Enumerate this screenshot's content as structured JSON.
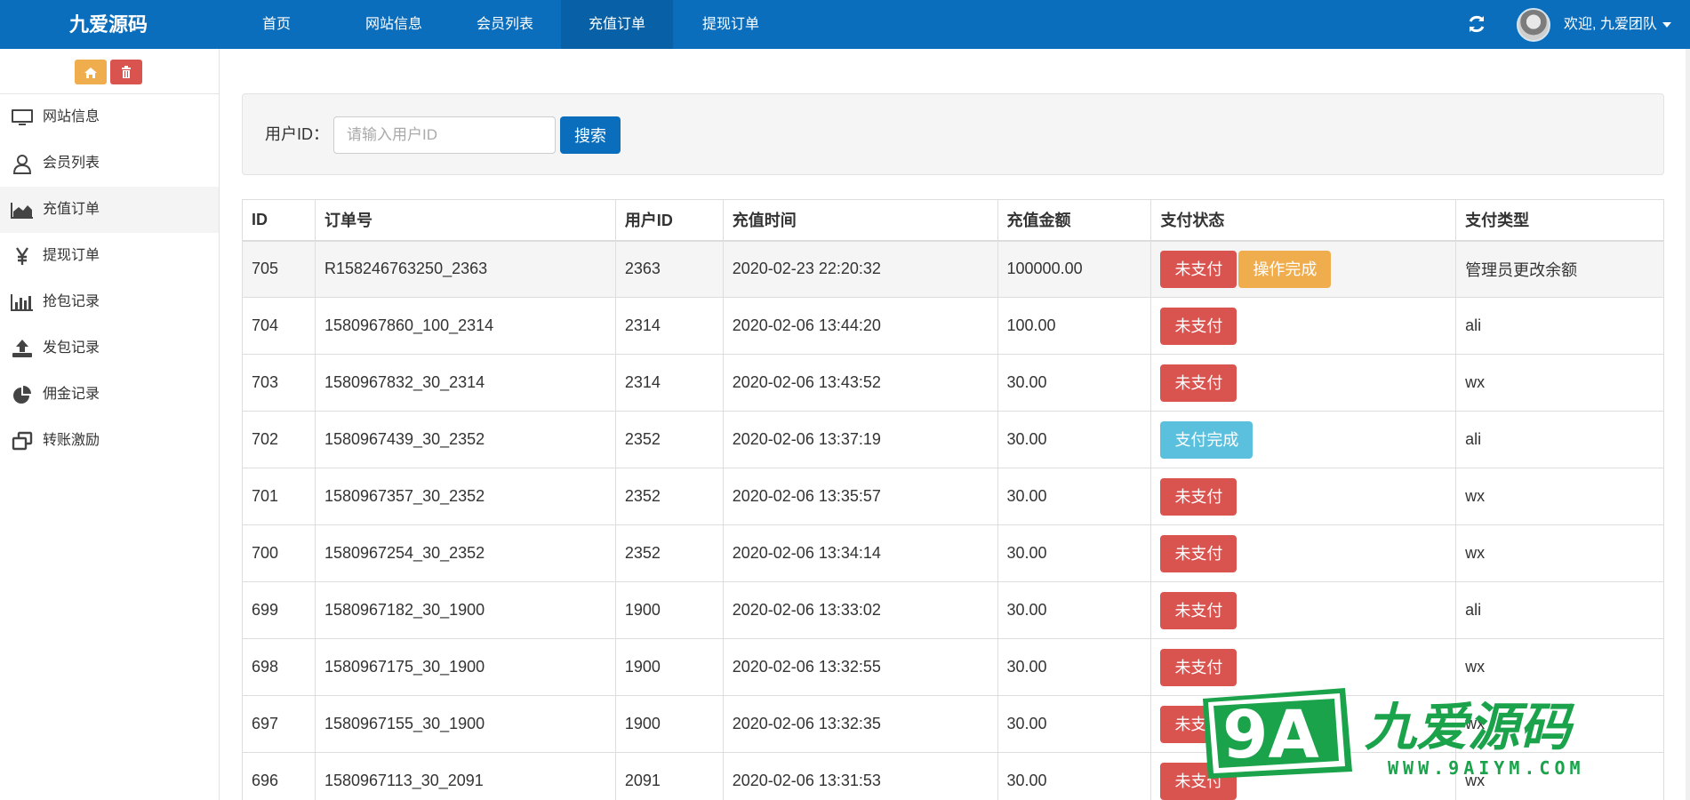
{
  "brand": {
    "name": "九爱源码"
  },
  "nav": {
    "items": [
      {
        "label": "首页",
        "active": false
      },
      {
        "label": "网站信息",
        "active": false
      },
      {
        "label": "会员列表",
        "active": false
      },
      {
        "label": "充值订单",
        "active": true
      },
      {
        "label": "提现订单",
        "active": false
      }
    ]
  },
  "header": {
    "welcome": "欢迎, 九爱团队"
  },
  "sidebar": {
    "items": [
      {
        "label": "网站信息",
        "icon": "monitor-icon"
      },
      {
        "label": "会员列表",
        "icon": "user-icon"
      },
      {
        "label": "充值订单",
        "icon": "area-chart-icon",
        "active": true
      },
      {
        "label": "提现订单",
        "icon": "yen-icon"
      },
      {
        "label": "抢包记录",
        "icon": "bar-chart-icon"
      },
      {
        "label": "发包记录",
        "icon": "upload-icon"
      },
      {
        "label": "佣金记录",
        "icon": "pie-chart-icon"
      },
      {
        "label": "转账激励",
        "icon": "clone-icon"
      }
    ]
  },
  "search": {
    "label": "用户ID：",
    "placeholder": "请输入用户ID",
    "button": "搜索",
    "value": ""
  },
  "table": {
    "headers": [
      "ID",
      "订单号",
      "用户ID",
      "充值时间",
      "充值金额",
      "支付状态",
      "支付类型"
    ],
    "rows": [
      {
        "id": "705",
        "order_no": "R158246763250_2363",
        "user_id": "2363",
        "time": "2020-02-23 22:20:32",
        "amount": "100000.00",
        "status": "未支付",
        "status_color": "#d9534f",
        "action": "操作完成",
        "type": "管理员更改余额",
        "highlight": true
      },
      {
        "id": "704",
        "order_no": "1580967860_100_2314",
        "user_id": "2314",
        "time": "2020-02-06 13:44:20",
        "amount": "100.00",
        "status": "未支付",
        "status_color": "#d9534f",
        "action": "",
        "type": "ali"
      },
      {
        "id": "703",
        "order_no": "1580967832_30_2314",
        "user_id": "2314",
        "time": "2020-02-06 13:43:52",
        "amount": "30.00",
        "status": "未支付",
        "status_color": "#d9534f",
        "action": "",
        "type": "wx"
      },
      {
        "id": "702",
        "order_no": "1580967439_30_2352",
        "user_id": "2352",
        "time": "2020-02-06 13:37:19",
        "amount": "30.00",
        "status": "支付完成",
        "status_color": "#5bc0de",
        "action": "",
        "type": "ali"
      },
      {
        "id": "701",
        "order_no": "1580967357_30_2352",
        "user_id": "2352",
        "time": "2020-02-06 13:35:57",
        "amount": "30.00",
        "status": "未支付",
        "status_color": "#d9534f",
        "action": "",
        "type": "wx"
      },
      {
        "id": "700",
        "order_no": "1580967254_30_2352",
        "user_id": "2352",
        "time": "2020-02-06 13:34:14",
        "amount": "30.00",
        "status": "未支付",
        "status_color": "#d9534f",
        "action": "",
        "type": "wx"
      },
      {
        "id": "699",
        "order_no": "1580967182_30_1900",
        "user_id": "1900",
        "time": "2020-02-06 13:33:02",
        "amount": "30.00",
        "status": "未支付",
        "status_color": "#d9534f",
        "action": "",
        "type": "ali"
      },
      {
        "id": "698",
        "order_no": "1580967175_30_1900",
        "user_id": "1900",
        "time": "2020-02-06 13:32:55",
        "amount": "30.00",
        "status": "未支付",
        "status_color": "#d9534f",
        "action": "",
        "type": "wx"
      },
      {
        "id": "697",
        "order_no": "1580967155_30_1900",
        "user_id": "1900",
        "time": "2020-02-06 13:32:35",
        "amount": "30.00",
        "status": "未支付",
        "status_color": "#d9534f",
        "action": "",
        "type": "wx"
      },
      {
        "id": "696",
        "order_no": "1580967113_30_2091",
        "user_id": "2091",
        "time": "2020-02-06 13:31:53",
        "amount": "30.00",
        "status": "未支付",
        "status_color": "#d9534f",
        "action": "",
        "type": "wx"
      }
    ]
  },
  "watermark": {
    "logo": "9A",
    "name": "九爱源码",
    "url": "WWW.9AIYM.COM"
  },
  "colors": {
    "primary": "#0a6ebd",
    "danger": "#d9534f",
    "warning": "#f0ad4e",
    "info": "#5bc0de",
    "watermark_green": "#1aa34a"
  }
}
